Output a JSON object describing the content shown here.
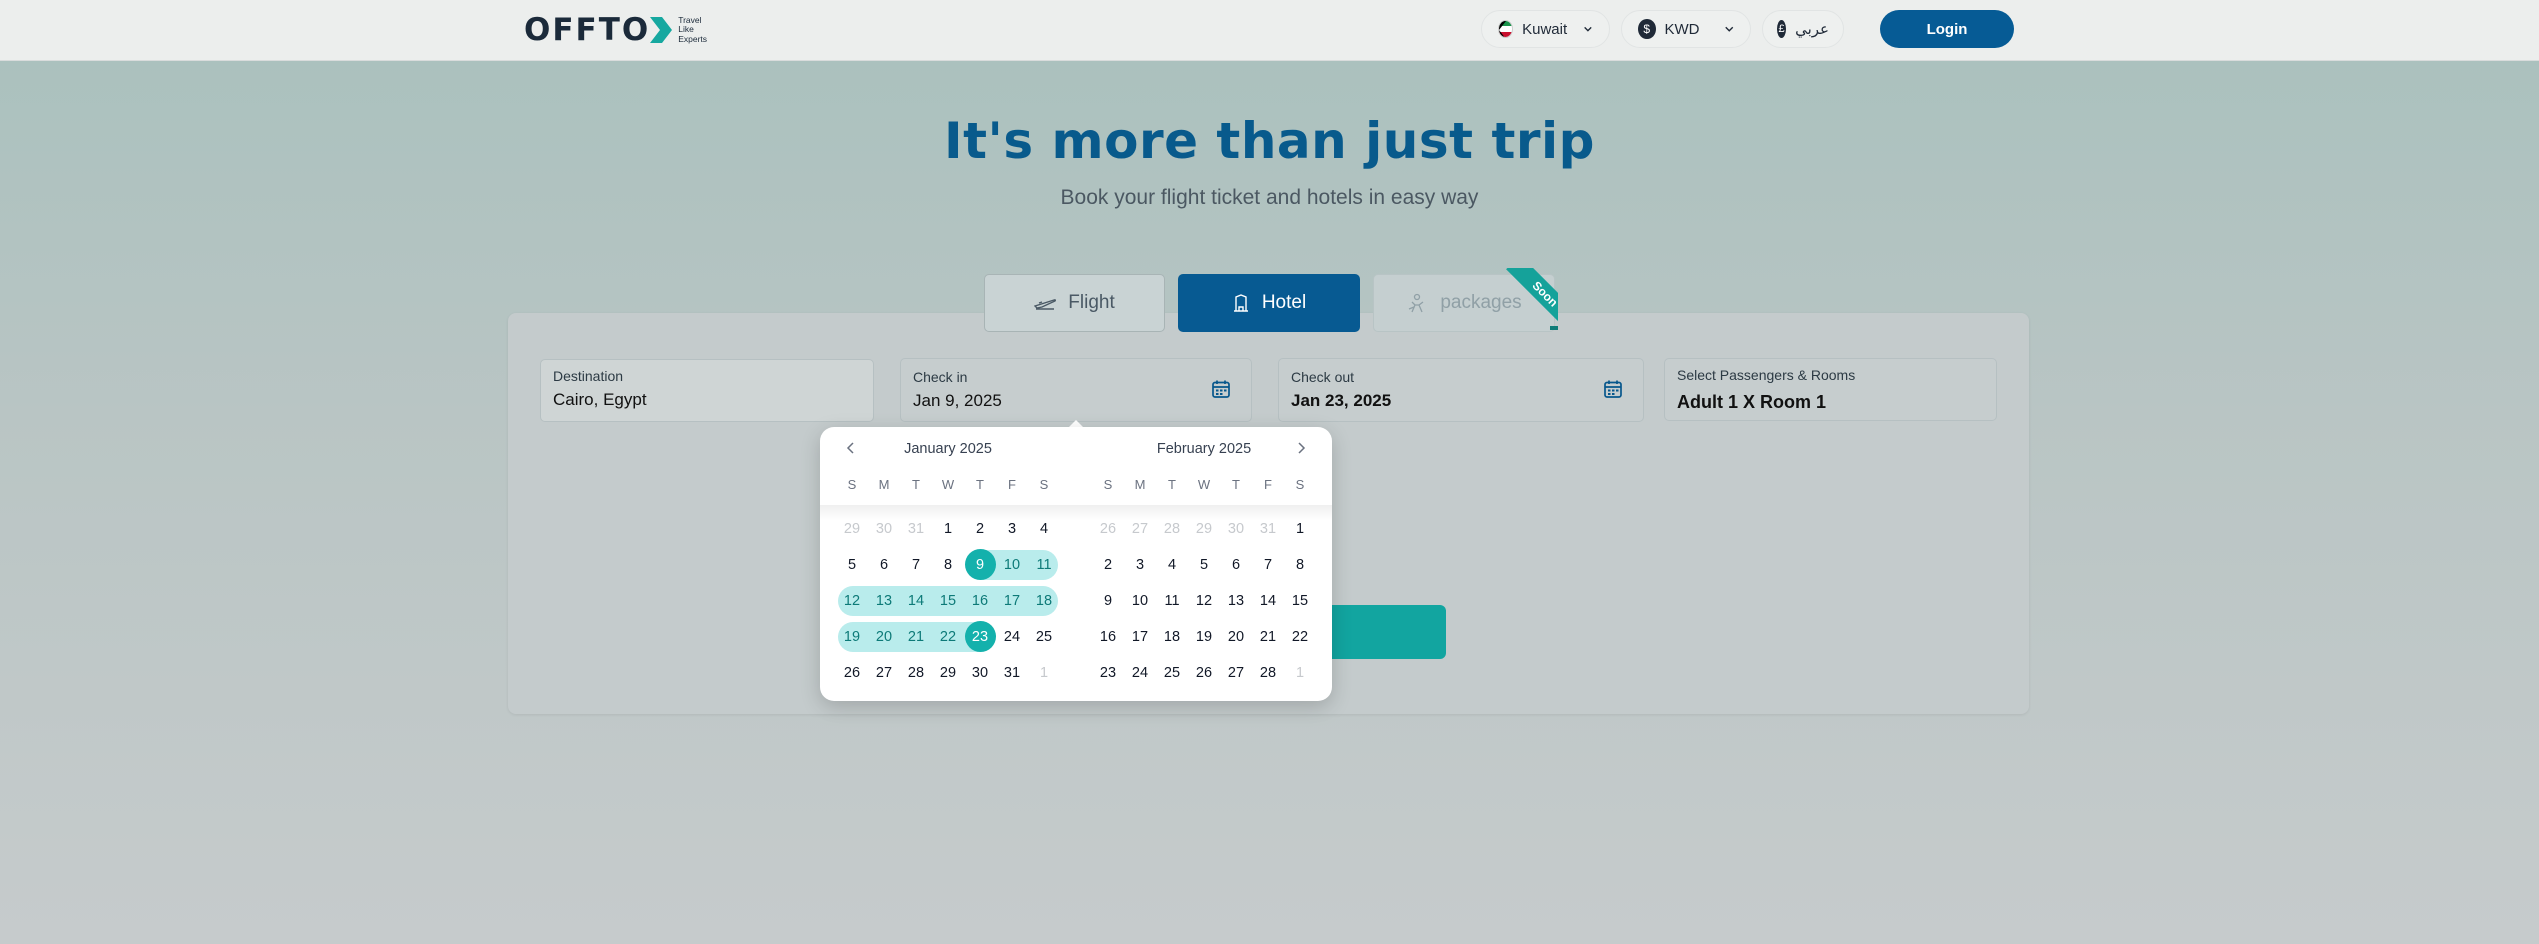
{
  "header": {
    "brand": "OFFTO",
    "tagline": [
      "Travel",
      "Like",
      "Experts"
    ],
    "country": "Kuwait",
    "currency": "KWD",
    "currency_symbol": "$",
    "language": "عربي",
    "language_symbol": "£",
    "login_label": "Login"
  },
  "hero": {
    "title": "It's more than just trip",
    "subtitle": "Book your flight ticket and hotels in easy way"
  },
  "tabs": {
    "flight": "Flight",
    "hotel": "Hotel",
    "packages": "packages",
    "soon_badge": "Soon",
    "active": "Hotel"
  },
  "search": {
    "destination_label": "Destination",
    "destination_value": "Cairo, Egypt",
    "checkin_label": "Check in",
    "checkin_value": "Jan 9, 2025",
    "checkout_label": "Check out",
    "checkout_value": "Jan 23, 2025",
    "pax_label": "Select Passengers & Rooms",
    "pax_value": "Adult 1  X Room 1"
  },
  "datepicker": {
    "weekdays": [
      "S",
      "M",
      "T",
      "W",
      "T",
      "F",
      "S"
    ],
    "months": [
      {
        "title": "January 2025",
        "days": [
          "29",
          "30",
          "31",
          "1",
          "2",
          "3",
          "4",
          "5",
          "6",
          "7",
          "8",
          "9",
          "10",
          "11",
          "12",
          "13",
          "14",
          "15",
          "16",
          "17",
          "18",
          "19",
          "20",
          "21",
          "22",
          "23",
          "24",
          "25",
          "26",
          "27",
          "28",
          "29",
          "30",
          "31",
          "1"
        ],
        "muted": [
          0,
          1,
          2,
          34
        ],
        "selected_start": 9,
        "selected_end": 23
      },
      {
        "title": "February 2025",
        "days": [
          "26",
          "27",
          "28",
          "29",
          "30",
          "31",
          "1",
          "2",
          "3",
          "4",
          "5",
          "6",
          "7",
          "8",
          "9",
          "10",
          "11",
          "12",
          "13",
          "14",
          "15",
          "16",
          "17",
          "18",
          "19",
          "20",
          "21",
          "22",
          "23",
          "24",
          "25",
          "26",
          "27",
          "28",
          "1"
        ],
        "muted": [
          0,
          1,
          2,
          3,
          4,
          5,
          34
        ]
      }
    ]
  },
  "colors": {
    "brand_blue": "#075a92",
    "teal": "#14b1ac",
    "range_fill": "#b9ecec"
  }
}
